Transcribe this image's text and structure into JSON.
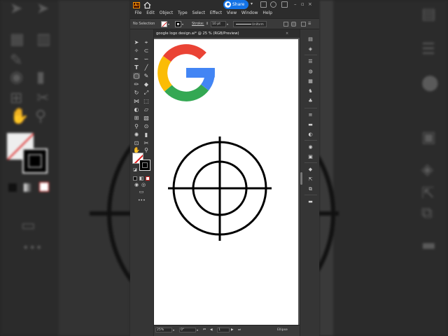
{
  "app": {
    "logo": "Ai",
    "share_label": "Share",
    "menus": [
      "File",
      "Edit",
      "Object",
      "Type",
      "Select",
      "Effect",
      "View",
      "Window",
      "Help"
    ]
  },
  "controlbar": {
    "selection": "No Selection",
    "stroke_label": "Stroke:",
    "stroke_weight": "10 pt",
    "profile": "Uniform"
  },
  "document": {
    "tab_title": "google logo design.ai* @ 25 % (RGB/Preview)",
    "close": "×"
  },
  "statusbar": {
    "zoom": "25%",
    "rotation": "0°",
    "artboard": "1",
    "tool": "Ellipse"
  },
  "colors": {
    "google_red": "#ea4335",
    "google_yellow": "#fbbc05",
    "google_green": "#34a853",
    "google_blue": "#4285f4",
    "accent": "#1473e6"
  },
  "icons": {
    "toolbar": [
      "selection-icon",
      "direct-selection-icon",
      "magic-wand-icon",
      "lasso-icon",
      "pen-icon",
      "curvature-icon",
      "type-icon",
      "line-icon",
      "rectangle-icon",
      "ellipse-icon",
      "paintbrush-icon",
      "pencil-icon",
      "eraser-icon",
      "scissors-icon",
      "rotate-icon",
      "scale-icon",
      "width-icon",
      "free-transform-icon",
      "shape-builder-icon",
      "perspective-icon",
      "mesh-icon",
      "gradient-icon",
      "eyedropper-icon",
      "blend-icon",
      "symbol-sprayer-icon",
      "graph-icon",
      "artboard-icon",
      "slice-icon",
      "hand-icon",
      "zoom-icon"
    ],
    "right_panel": [
      "properties-icon",
      "layers-icon",
      "libraries-icon",
      "color-icon",
      "swatches-icon",
      "brushes-icon",
      "symbols-icon",
      "stroke-icon",
      "gradient-panel-icon",
      "transparency-icon",
      "appearance-icon",
      "graphic-styles-icon",
      "align-icon",
      "pathfinder-icon",
      "transform-icon",
      "export-icon",
      "links-icon",
      "comments-icon"
    ]
  }
}
